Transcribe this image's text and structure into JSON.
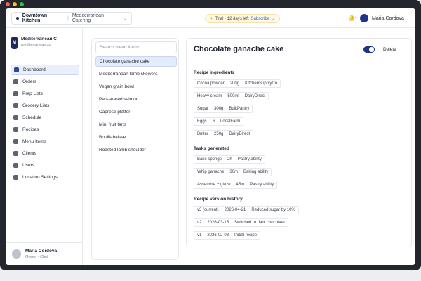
{
  "topbar": {
    "location": "Downtown Kitchen",
    "brand": "Mediterranean Catering",
    "trial_text": "Trial · 12 days left",
    "subscribe": "Subscribe →",
    "user_name": "Maria Cordova"
  },
  "sidebar": {
    "brand_name": "Mediterranean C",
    "brand_url": "mediterranean.sc",
    "items": [
      {
        "label": "Dashboard",
        "active": true
      },
      {
        "label": "Orders"
      },
      {
        "label": "Prep Lists"
      },
      {
        "label": "Grocery Lists"
      },
      {
        "label": "Schedule"
      },
      {
        "label": "Recipes"
      },
      {
        "label": "Menu Items"
      },
      {
        "label": "Clients"
      },
      {
        "label": "Users"
      },
      {
        "label": "Location Settings"
      }
    ],
    "footer": {
      "name": "Maria Cordova",
      "role": "Owner · Chef"
    }
  },
  "menu_list": {
    "search_placeholder": "Search menu items...",
    "items": [
      {
        "label": "Chocolate ganache cake",
        "active": true
      },
      {
        "label": "Mediterranean lamb skewers"
      },
      {
        "label": "Vegan grain bowl"
      },
      {
        "label": "Pan-seared salmon"
      },
      {
        "label": "Caprese platter"
      },
      {
        "label": "Mini fruit tarts"
      },
      {
        "label": "Bouillabaisse"
      },
      {
        "label": "Roasted lamb shoulder"
      }
    ]
  },
  "detail": {
    "title": "Chocolate ganache cake",
    "toggle_on": true,
    "delete_label": "Delete",
    "ingredients_title": "Recipe ingredients",
    "ingredients": [
      {
        "name": "Cocoa powder",
        "qty": "200g",
        "supplier": "KitchenSupplyCo"
      },
      {
        "name": "Heavy cream",
        "qty": "500ml",
        "supplier": "DairyDirect"
      },
      {
        "name": "Sugar",
        "qty": "300g",
        "supplier": "BulkPantry"
      },
      {
        "name": "Eggs",
        "qty": "6",
        "supplier": "LocalFarm"
      },
      {
        "name": "Butter",
        "qty": "250g",
        "supplier": "DairyDirect"
      }
    ],
    "tasks_title": "Tasks generated",
    "tasks": [
      {
        "name": "Bake sponge",
        "time": "2h",
        "ability": "Pastry ability"
      },
      {
        "name": "Whip ganache",
        "time": "30m",
        "ability": "Baking ability"
      },
      {
        "name": "Assemble + glaze",
        "time": "45m",
        "ability": "Pastry ability"
      }
    ],
    "history_title": "Recipe version history",
    "history": [
      {
        "version": "v3 (current)",
        "date": "2026-04-21",
        "note": "Reduced sugar by 10%"
      },
      {
        "version": "v2",
        "date": "2026-03-15",
        "note": "Switched to dark chocolate"
      },
      {
        "version": "v1",
        "date": "2026-02-08",
        "note": "Initial recipe"
      }
    ]
  }
}
